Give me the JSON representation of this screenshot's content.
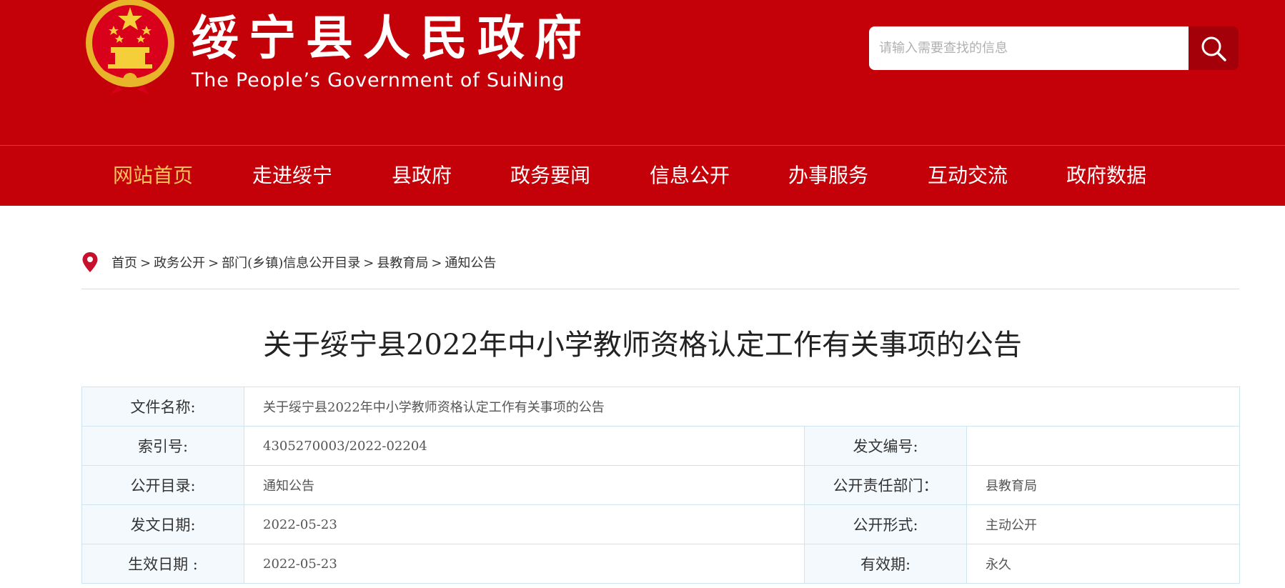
{
  "header": {
    "title": "绥宁县人民政府",
    "subtitle": "The People’s Government of SuiNing",
    "emblem_icon": "national-emblem-icon"
  },
  "search": {
    "placeholder": "请输入需要查找的信息",
    "button_icon": "search-icon"
  },
  "nav": {
    "items": [
      {
        "label": "网站首页",
        "active": true
      },
      {
        "label": "走进绥宁",
        "active": false
      },
      {
        "label": "县政府",
        "active": false
      },
      {
        "label": "政务要闻",
        "active": false
      },
      {
        "label": "信息公开",
        "active": false
      },
      {
        "label": "办事服务",
        "active": false
      },
      {
        "label": "互动交流",
        "active": false
      },
      {
        "label": "政府数据",
        "active": false
      }
    ]
  },
  "breadcrumb": {
    "icon": "location-pin-icon",
    "items": [
      "首页",
      "政务公开",
      "部门(乡镇)信息公开目录",
      "县教育局",
      "通知公告"
    ],
    "separator": ">"
  },
  "article": {
    "title": "关于绥宁县2022年中小学教师资格认定工作有关事项的公告"
  },
  "meta": {
    "file_name_label": "文件名称:",
    "file_name": "关于绥宁县2022年中小学教师资格认定工作有关事项的公告",
    "index_label": "索引号:",
    "index": "4305270003/2022-02204",
    "doc_no_label": "发文编号:",
    "doc_no": "",
    "catalog_label": "公开目录:",
    "catalog": "通知公告",
    "dept_label": "公开责任部门：",
    "dept": "县教育局",
    "issue_date_label": "发文日期:",
    "issue_date": "2022-05-23",
    "form_label": "公开形式:",
    "form": "主动公开",
    "effective_date_label": "生效日期 :",
    "effective_date": "2022-05-23",
    "validity_label": "有效期:",
    "validity": "永久"
  },
  "colors": {
    "brand_red": "#c40008",
    "active_nav": "#f7c35c",
    "table_border": "#cfe4f1"
  }
}
